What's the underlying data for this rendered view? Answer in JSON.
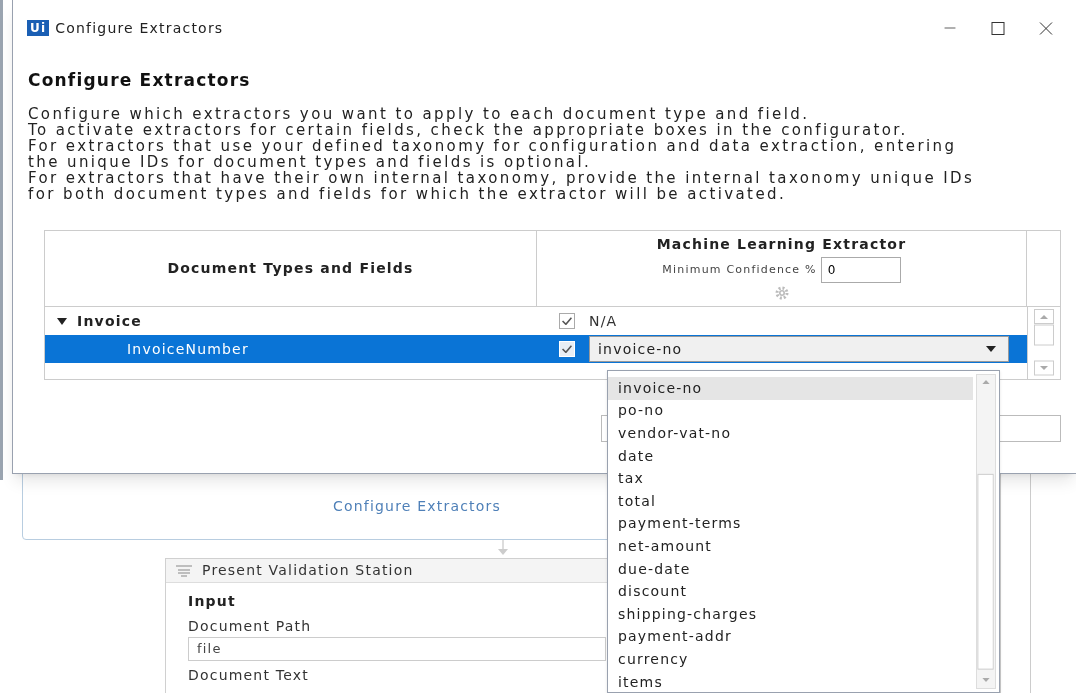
{
  "window": {
    "title": "Configure Extractors",
    "logo": "Ui"
  },
  "heading": "Configure Extractors",
  "description": [
    "Configure which extractors you want to apply to each document type and field.",
    "To activate extractors for certain fields, check the appropriate boxes in the configurator.",
    "For extractors that use your defined taxonomy for configuration and data extraction, entering",
    "the unique IDs for document types and fields is optional.",
    "For extractors that have their own internal taxonomy, provide the internal taxonomy unique IDs",
    "for both document types and fields for which the extractor will be activated."
  ],
  "table": {
    "column_1": "Document Types and Fields",
    "extractor": {
      "name": "Machine Learning Extractor",
      "confidence_label": "Minimum Confidence %",
      "confidence_value": "0"
    },
    "rows": [
      {
        "label": "Invoice",
        "expanded": true,
        "checked": true,
        "value": "N/A",
        "selected": false,
        "children": [
          {
            "label": "InvoiceNumber",
            "checked": true,
            "value": "invoice-no",
            "selected": true
          }
        ]
      }
    ]
  },
  "dropdown": {
    "options": [
      {
        "label": "invoice-no",
        "selected": true
      },
      {
        "label": "po-no",
        "selected": false
      },
      {
        "label": "vendor-vat-no",
        "selected": false
      },
      {
        "label": "date",
        "selected": false
      },
      {
        "label": "tax",
        "selected": false
      },
      {
        "label": "total",
        "selected": false
      },
      {
        "label": "payment-terms",
        "selected": false
      },
      {
        "label": "net-amount",
        "selected": false
      },
      {
        "label": "due-date",
        "selected": false
      },
      {
        "label": "discount",
        "selected": false
      },
      {
        "label": "shipping-charges",
        "selected": false
      },
      {
        "label": "payment-addr",
        "selected": false
      },
      {
        "label": "currency",
        "selected": false
      },
      {
        "label": "items",
        "selected": false
      }
    ]
  },
  "designer": {
    "link": "Configure Extractors",
    "activity": {
      "title": "Present Validation Station",
      "section": "Input",
      "fields": [
        {
          "label": "Document Path",
          "value": "file"
        },
        {
          "label": "Document Text"
        }
      ]
    }
  }
}
